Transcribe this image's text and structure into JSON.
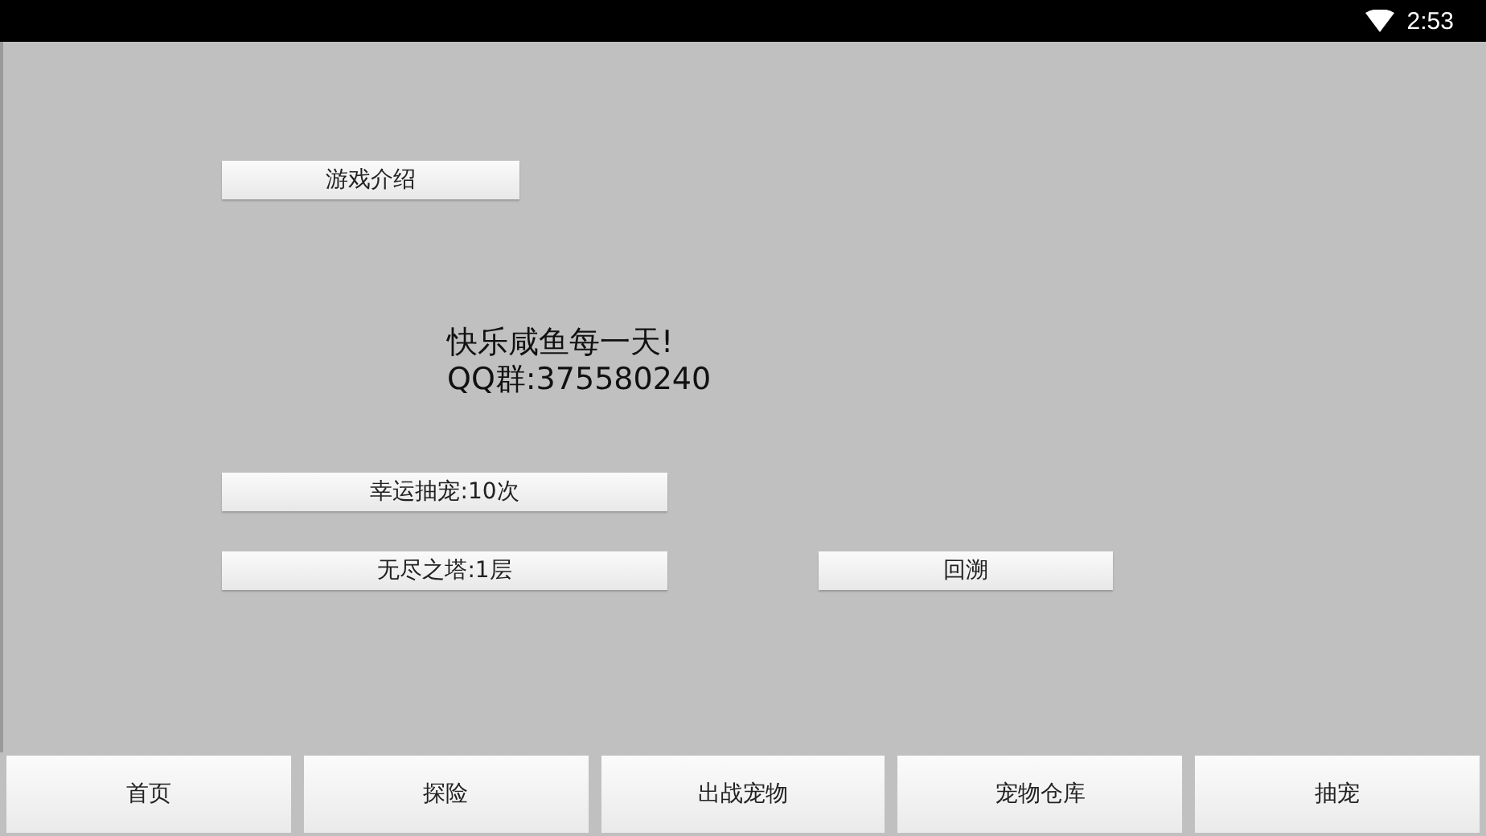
{
  "status_bar": {
    "time": "2:53"
  },
  "intro_button": "游戏介绍",
  "message": [
    "快乐咸鱼每一天!",
    "QQ群:375580240"
  ],
  "lucky_draw_button": "幸运抽宠:10次",
  "tower_button": "无尽之塔:1层",
  "rewind_button": "回溯",
  "nav": [
    {
      "label": "首页"
    },
    {
      "label": "探险"
    },
    {
      "label": "出战宠物"
    },
    {
      "label": "宠物仓库"
    },
    {
      "label": "抽宠"
    }
  ]
}
